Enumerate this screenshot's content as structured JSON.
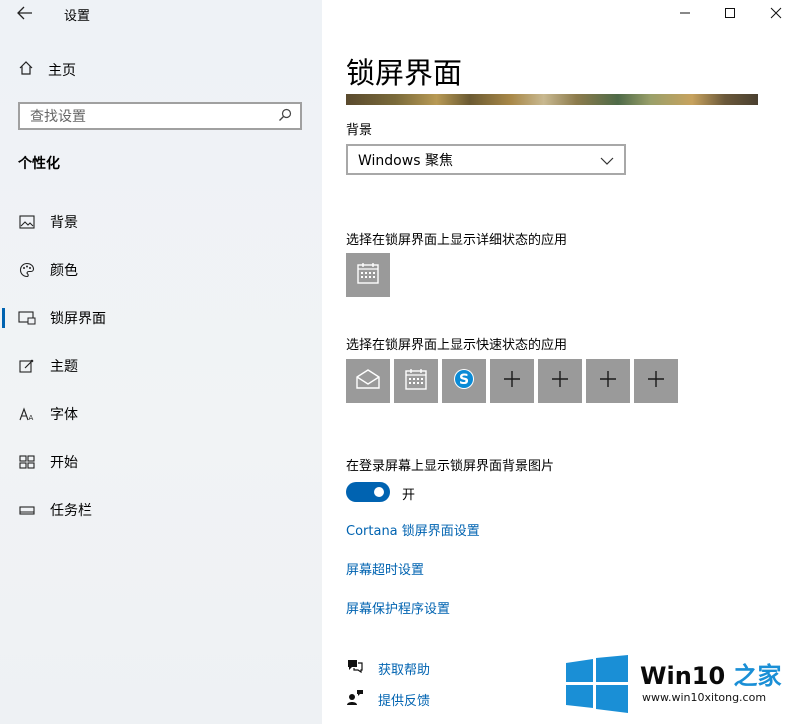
{
  "window": {
    "title": "设置",
    "controls": {
      "minimize": "—",
      "maximize": "☐",
      "close": "✕"
    }
  },
  "sidebar": {
    "home_label": "主页",
    "search_placeholder": "查找设置",
    "section_title": "个性化",
    "items": [
      {
        "label": "背景",
        "icon": "image-icon"
      },
      {
        "label": "颜色",
        "icon": "palette-icon"
      },
      {
        "label": "锁屏界面",
        "icon": "lock-screen-icon",
        "selected": true
      },
      {
        "label": "主题",
        "icon": "theme-icon"
      },
      {
        "label": "字体",
        "icon": "font-icon"
      },
      {
        "label": "开始",
        "icon": "start-icon"
      },
      {
        "label": "任务栏",
        "icon": "taskbar-icon"
      }
    ]
  },
  "main": {
    "title": "锁屏界面",
    "background_label": "背景",
    "background_value": "Windows 聚焦",
    "detailed_status_label": "选择在锁屏界面上显示详细状态的应用",
    "quick_status_label": "选择在锁屏界面上显示快速状态的应用",
    "quick_tiles": [
      "mail-icon",
      "calendar-icon",
      "skype-icon",
      "plus-icon",
      "plus-icon",
      "plus-icon",
      "plus-icon"
    ],
    "login_bg_label": "在登录屏幕上显示锁屏界面背景图片",
    "toggle_state": "开",
    "toggle_on": true,
    "links": [
      "Cortana 锁屏界面设置",
      "屏幕超时设置",
      "屏幕保护程序设置"
    ],
    "help": {
      "get_help": "获取帮助",
      "feedback": "提供反馈"
    }
  },
  "watermark": {
    "title_main": "Win10 ",
    "title_accent": "之家",
    "url": "www.win10xitong.com"
  },
  "colors": {
    "accent": "#0063b1",
    "tile": "#9a9a9a",
    "brand_blue": "#1a8fd6"
  }
}
